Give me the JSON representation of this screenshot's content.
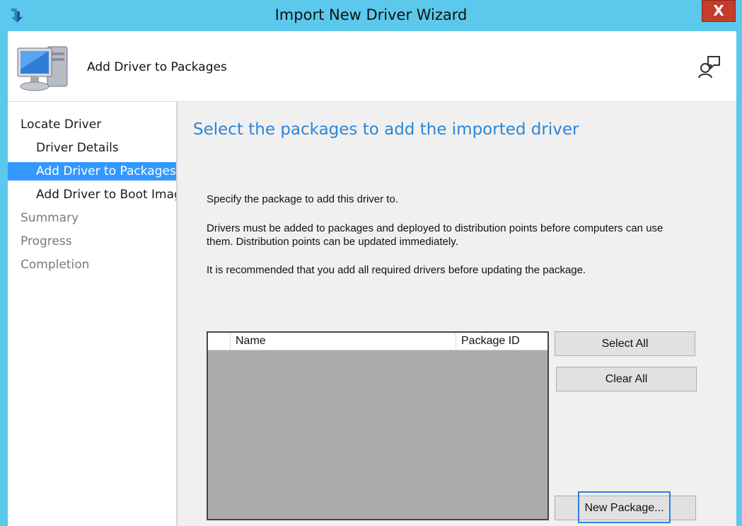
{
  "window": {
    "title": "Import New Driver Wizard",
    "close_label": "X"
  },
  "header": {
    "title": "Add Driver to Packages"
  },
  "icons": {
    "app": "wizard-arrow-icon",
    "header": "computer-icon",
    "help": "help-icon"
  },
  "colors": {
    "accent": "#3399ff",
    "heading": "#2a86d8",
    "titlebar": "#5bc8ec",
    "close": "#c43d2a"
  },
  "sidebar": {
    "items": [
      {
        "label": "Locate Driver"
      },
      {
        "label": "Driver Details"
      },
      {
        "label": "Add Driver to Packages"
      },
      {
        "label": "Add Driver to Boot Image"
      },
      {
        "label": "Summary"
      },
      {
        "label": "Progress"
      },
      {
        "label": "Completion"
      }
    ]
  },
  "main": {
    "heading": "Select the packages to add the imported driver",
    "para1": "Specify the package to add this driver to.",
    "para2_line1": "Drivers must be added to packages and deployed to distribution points before computers can use",
    "para2_line2": "them.  Distribution points can be updated immediately.",
    "para3": "It is recommended that you add all required drivers before updating the package.",
    "table": {
      "columns": [
        "Name",
        "Package ID"
      ],
      "rows": []
    },
    "buttons": {
      "select_all": "Select All",
      "clear_all": "Clear All",
      "new_package": "New Package..."
    }
  }
}
